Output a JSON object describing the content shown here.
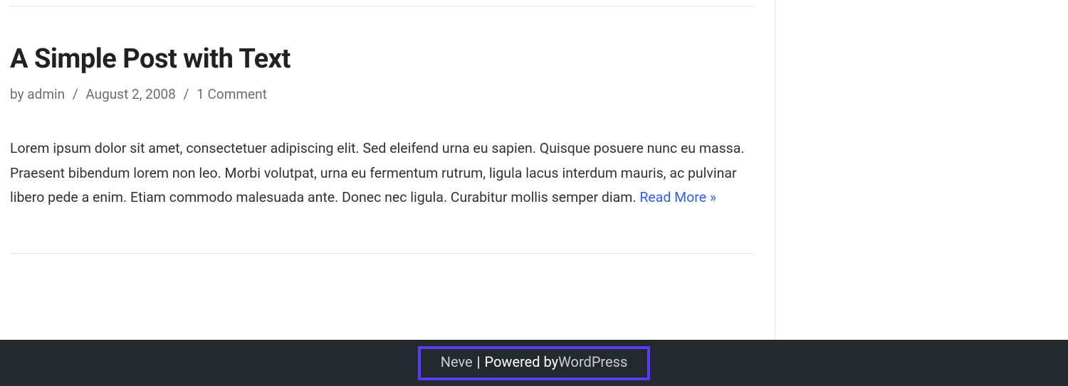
{
  "post": {
    "title": "A Simple Post with Text",
    "meta": {
      "by_label": "by ",
      "author": "admin",
      "sep": " / ",
      "date": "August 2, 2008",
      "comments": "1 Comment"
    },
    "excerpt": "Lorem ipsum dolor sit amet, consectetuer adipiscing elit. Sed eleifend urna eu sapien. Quisque posuere nunc eu massa. Praesent bibendum lorem non leo. Morbi volutpat, urna eu fermentum rutrum, ligula lacus interdum mauris, ac pulvinar libero pede a enim. Etiam commodo malesuada ante. Donec nec ligula. Curabitur mollis semper diam. ",
    "read_more": "Read More »"
  },
  "footer": {
    "theme": "Neve",
    "pipe": " | ",
    "powered_label": "Powered by ",
    "platform": "WordPress"
  }
}
